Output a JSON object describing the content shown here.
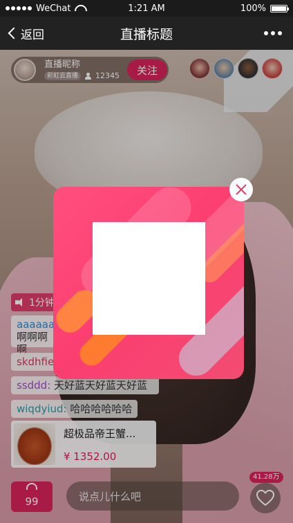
{
  "status_bar": {
    "carrier": "WeChat",
    "time": "1:21 AM",
    "battery": "100%",
    "battery_level_percent": 100
  },
  "nav": {
    "back_label": "返回",
    "title": "直播标题"
  },
  "host": {
    "name": "直播昵称",
    "badge": "彩虹云直播",
    "viewer_count": "12345",
    "follow_label": "关注"
  },
  "comments": {
    "notice": "1分钟",
    "items": [
      {
        "user": "aaaaaa",
        "text": "啊啊啊啊"
      },
      {
        "user": "skdhfie",
        "text": ""
      },
      {
        "user": "ssddd:",
        "text": "天好蓝天好蓝天好蓝"
      },
      {
        "user": "wiqdyiud:",
        "text": "哈哈哈哈哈哈"
      }
    ]
  },
  "product": {
    "name": "超极品帝王蟹...",
    "price": "¥ 1352.00"
  },
  "bottom": {
    "bag_count": "99",
    "input_placeholder": "说点儿什么吧",
    "like_count": "41.28万"
  },
  "colors": {
    "accent": "#d8235a",
    "popup": "#fb3e70"
  },
  "icons": [
    "back-chevron-icon",
    "more-dots-icon",
    "user-icon",
    "speaker-icon",
    "bag-icon",
    "heart-icon",
    "close-icon"
  ]
}
